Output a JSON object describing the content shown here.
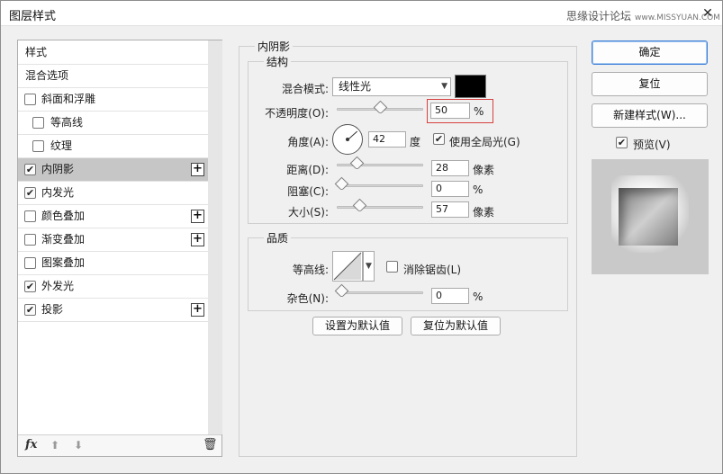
{
  "window": {
    "title": "图层样式",
    "watermark": "思缘设计论坛",
    "watermark_url": "www.MISSYUAN.COM",
    "close_glyph": "✕"
  },
  "style_list": {
    "items": [
      {
        "label": "样式",
        "has_checkbox": false,
        "checked": false,
        "selected": false,
        "plus": false
      },
      {
        "label": "混合选项",
        "has_checkbox": false,
        "checked": false,
        "selected": false,
        "plus": false
      },
      {
        "label": "斜面和浮雕",
        "has_checkbox": true,
        "checked": false,
        "selected": false,
        "plus": false
      },
      {
        "label": "等高线",
        "has_checkbox": true,
        "checked": false,
        "selected": false,
        "plus": false
      },
      {
        "label": "纹理",
        "has_checkbox": true,
        "checked": false,
        "selected": false,
        "plus": false
      },
      {
        "label": "内阴影",
        "has_checkbox": true,
        "checked": true,
        "selected": true,
        "plus": true
      },
      {
        "label": "内发光",
        "has_checkbox": true,
        "checked": true,
        "selected": false,
        "plus": false
      },
      {
        "label": "颜色叠加",
        "has_checkbox": true,
        "checked": false,
        "selected": false,
        "plus": true
      },
      {
        "label": "渐变叠加",
        "has_checkbox": true,
        "checked": false,
        "selected": false,
        "plus": true
      },
      {
        "label": "图案叠加",
        "has_checkbox": true,
        "checked": false,
        "selected": false,
        "plus": false
      },
      {
        "label": "外发光",
        "has_checkbox": true,
        "checked": true,
        "selected": false,
        "plus": false
      },
      {
        "label": "投影",
        "has_checkbox": true,
        "checked": true,
        "selected": false,
        "plus": true
      }
    ],
    "footer": {
      "fx_label": "fx",
      "up_glyph": "⬆",
      "down_glyph": "⬇",
      "trash_glyph": "🗑"
    },
    "check_glyph": "✔",
    "plus_glyph": "+"
  },
  "inner_shadow": {
    "title": "内阴影",
    "structure": {
      "title": "结构",
      "blend_mode_label": "混合模式:",
      "blend_mode_value": "线性光",
      "shadow_color": "#000000",
      "opacity_label": "不透明度(O):",
      "opacity_value": "50",
      "opacity_unit": "%",
      "opacity_fraction": 0.5,
      "angle_label": "角度(A):",
      "angle_value": "42",
      "angle_unit": "度",
      "global_light_label": "使用全局光(G)",
      "global_light_checked": true,
      "distance_label": "距离(D):",
      "distance_value": "28",
      "distance_unit": "像素",
      "distance_fraction": 0.2,
      "choke_label": "阻塞(C):",
      "choke_value": "0",
      "choke_unit": "%",
      "choke_fraction": 0.0,
      "size_label": "大小(S):",
      "size_value": "57",
      "size_unit": "像素",
      "size_fraction": 0.23
    },
    "quality": {
      "title": "品质",
      "contour_label": "等高线:",
      "anti_alias_label": "消除锯齿(L)",
      "anti_alias_checked": false,
      "noise_label": "杂色(N):",
      "noise_value": "0",
      "noise_unit": "%",
      "noise_fraction": 0.0
    },
    "set_default_label": "设置为默认值",
    "reset_default_label": "复位为默认值"
  },
  "actions": {
    "ok_label": "确定",
    "reset_label": "复位",
    "new_style_label": "新建样式(W)...",
    "preview_label": "预览(V)",
    "preview_checked": true
  }
}
